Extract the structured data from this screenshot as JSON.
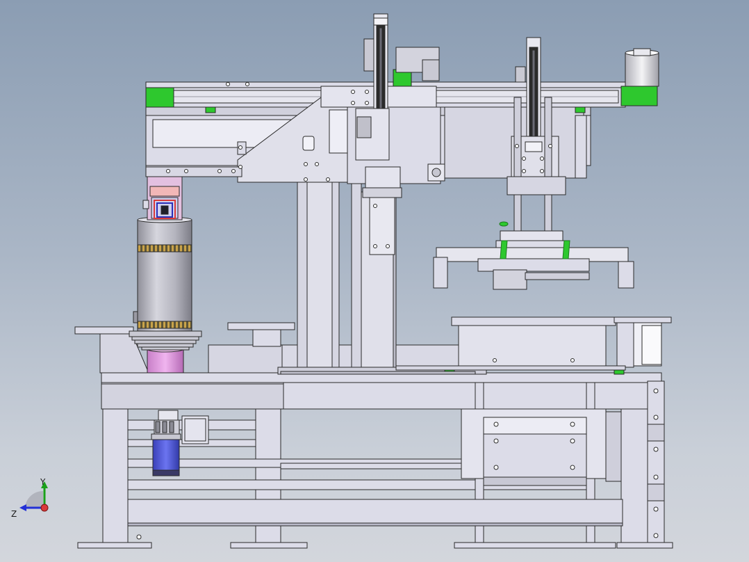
{
  "view": {
    "type": "CAD assembly model, front view",
    "colors": {
      "background_top": "#8b9db3",
      "background_bottom": "#d3d6dc",
      "part_fill": "#dcdce8",
      "part_fill_dark": "#b9b9c9",
      "edge": "#2a2a2a",
      "accent_green": "#2ec82e",
      "accent_magenta": "#e79ae6",
      "accent_blue": "#4f58d9",
      "accent_gold": "#c9a34a",
      "accent_red": "#d93a3a"
    }
  },
  "axes": {
    "y_label": "Y",
    "z_label": "Z"
  }
}
